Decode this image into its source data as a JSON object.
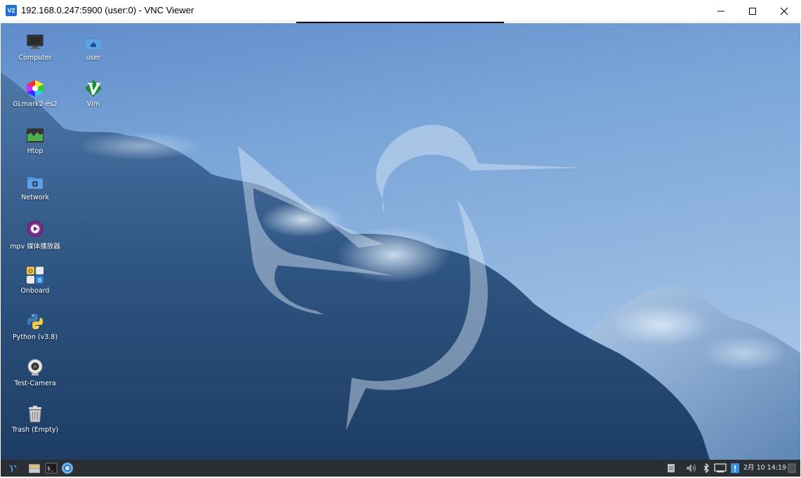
{
  "window": {
    "title": "192.168.0.247:5900 (user:0) - VNC Viewer",
    "app_icon_label": "V2",
    "controls": [
      "minimize-icon",
      "maximize-icon",
      "close-icon"
    ]
  },
  "desktop": {
    "icons": [
      {
        "label": "Computer",
        "icon": "computer-icon"
      },
      {
        "label": "user",
        "icon": "home-folder-icon"
      },
      {
        "label": "GLmark2-es2",
        "icon": "glmark-icon"
      },
      {
        "label": "Vim",
        "icon": "vim-icon"
      },
      {
        "label": "Htop",
        "icon": "htop-icon"
      },
      {
        "label": "Network",
        "icon": "network-folder-icon"
      },
      {
        "label": "mpv 媒体播放器",
        "icon": "mpv-icon"
      },
      {
        "label": "Onboard",
        "icon": "onboard-keyboard-icon"
      },
      {
        "label": "Python (v3.8)",
        "icon": "python-icon"
      },
      {
        "label": "Test-Camera",
        "icon": "webcam-icon"
      },
      {
        "label": "Trash (Empty)",
        "icon": "trash-icon"
      }
    ]
  },
  "panel": {
    "launchers": [
      "app-menu-icon",
      "file-manager-icon",
      "terminal-icon",
      "browser-icon"
    ],
    "tray": [
      "clipboard-icon",
      "volume-icon",
      "bluetooth-icon",
      "network-icon",
      "notification-icon"
    ],
    "clock": "2月 10 14:19"
  },
  "colors": {
    "panel_bg": "#2b2f33",
    "sky_top": "#6f9cd2",
    "sky_bottom": "#23466f"
  }
}
